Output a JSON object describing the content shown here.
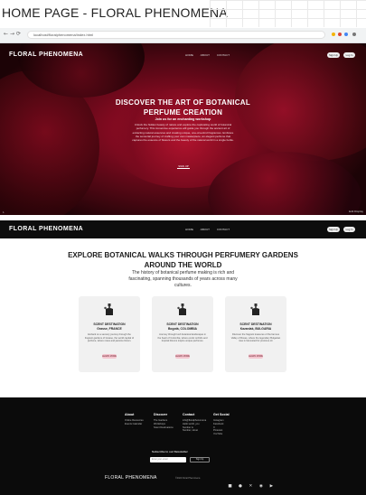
{
  "title": "HOME PAGE - FLORAL PHENOMENA",
  "browser": {
    "url": "localhost/floralphenomena/index.html",
    "back_glyph": "←",
    "forward_glyph": "→",
    "reload_glyph": "⟳"
  },
  "brand": "FLORAL PHENOMENA",
  "nav": {
    "links": [
      "HOME",
      "ABOUT",
      "CONTACT"
    ],
    "sign_up": "Sign Up",
    "log_in": "Log In"
  },
  "hero": {
    "heading_line1": "DISCOVER THE ART OF BOTANICAL",
    "heading_line2": "PERFUME CREATION",
    "subheading": "Join us for an enchanting workshop",
    "body": "Unlock the hidden beauty of nature and explore the captivating world of botanical perfumery. This immersive experience will guide you through the ancient art of extracting natural essences and creating unique, one-of-a-kind fragrances. Embrace the sensorial journey of crafting your own masterpiece, an elegant perfume that captures the essence of flowers and the beauty of the natural world in a single bottle.",
    "cta": "SIGN UP",
    "corner_left": "1",
    "corner_right": "Edit Display"
  },
  "walks": {
    "heading_line1": "EXPLORE BOTANICAL WALKS THROUGH PERFUMERY GARDENS",
    "heading_line2": "AROUND THE WORLD",
    "paragraph": "The history of botanical perfume making is rich and fascinating, spanning thousands of years across many cultures.",
    "cards": [
      {
        "title": "SCENT DESTINATION",
        "location": "Grasse, FRANCE",
        "body": "Embark on a sensory journey through the fragrant gardens of Grasse, the world capital of perfume, where roses and jasmine bloom.",
        "button": "LEARN MORE"
      },
      {
        "title": "SCENT DESTINATION",
        "location": "Bogotá, COLOMBIA",
        "body": "Journey through lush botanical landscapes in the heart of Colombia, where exotic orchids and tropical blooms inspire unique perfumes.",
        "button": "LEARN MORE"
      },
      {
        "title": "SCENT DESTINATION",
        "location": "Kazanlak, BULGARIA",
        "body": "Discover the fragrant treasures of the famous Valley of Roses, where the legendary Bulgarian rose is harvested for precious oil.",
        "button": "LEARN MORE"
      }
    ]
  },
  "footer": {
    "columns": [
      {
        "head": "About",
        "lines": [
          "Online Resources",
          "Events Calendar"
        ]
      },
      {
        "head": "Discover",
        "lines": [
          "The Gardens",
          "Workshops",
          "Scent Destinations"
        ]
      },
      {
        "head": "Contact",
        "lines": [
          "info@floralphenomena",
          "Hello world, you",
          "Number is",
          "Number, street"
        ]
      },
      {
        "head": "Get Social",
        "lines": [
          "Instagram",
          "Facebook",
          "X",
          "Pinterest",
          "YouTube"
        ]
      }
    ],
    "newsletter_label": "Subscribe to our Newsletter",
    "newsletter_placeholder": "Enter your email",
    "newsletter_button": "Sign Up",
    "brand": "FLORAL PHENOMENA",
    "copyright": "©2024 Floral Phenomena",
    "social_glyphs": [
      "■",
      "●",
      "✕",
      "◉",
      "▶"
    ]
  },
  "colors": {
    "rose": "#8e0d24",
    "dark": "#0b0b0b",
    "card_bg": "#f1f1f1",
    "card_button": "#f4c6cf"
  },
  "icons": [
    "back-arrow-icon",
    "forward-arrow-icon",
    "reload-icon",
    "perfume-bottle-icon",
    "instagram-icon",
    "facebook-icon",
    "x-icon",
    "pinterest-icon",
    "youtube-icon"
  ]
}
